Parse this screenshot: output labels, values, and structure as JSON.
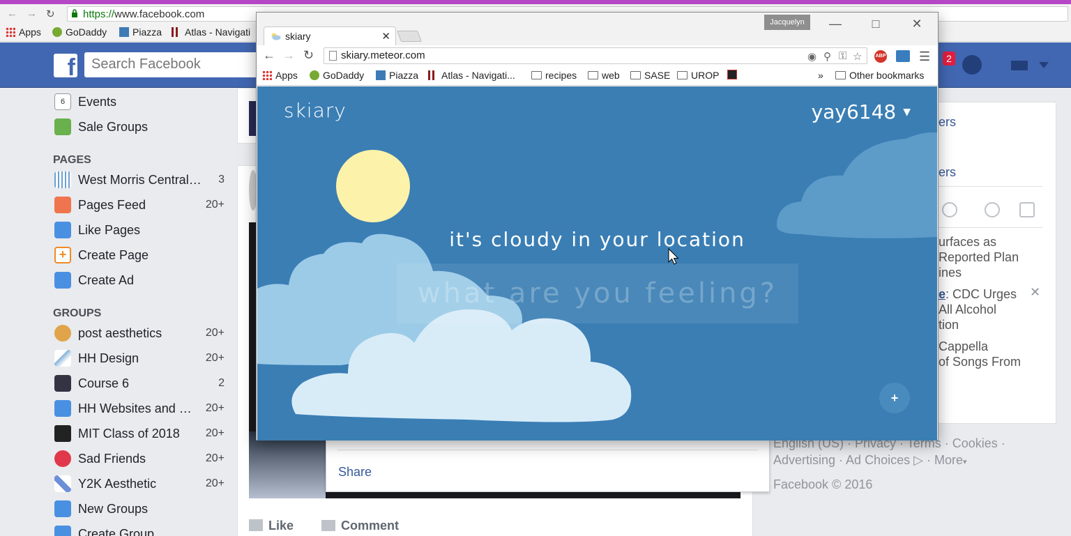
{
  "bg_browser": {
    "url_https": "https://",
    "url_rest": "www.facebook.com",
    "bookmarks": [
      "Apps",
      "GoDaddy",
      "Piazza",
      "Atlas - Navigati"
    ]
  },
  "facebook": {
    "search_placeholder": "Search Facebook",
    "explore": [
      {
        "label": "Events",
        "count": ""
      },
      {
        "label": "Sale Groups",
        "count": ""
      }
    ],
    "pages_heading": "PAGES",
    "pages": [
      {
        "label": "West Morris Central…",
        "count": "3"
      },
      {
        "label": "Pages Feed",
        "count": "20+"
      },
      {
        "label": "Like Pages",
        "count": ""
      },
      {
        "label": "Create Page",
        "count": ""
      },
      {
        "label": "Create Ad",
        "count": ""
      }
    ],
    "groups_heading": "GROUPS",
    "groups": [
      {
        "label": "post aesthetics",
        "count": "20+"
      },
      {
        "label": "HH Design",
        "count": "20+"
      },
      {
        "label": "Course 6",
        "count": "2"
      },
      {
        "label": "HH Websites and …",
        "count": "20+"
      },
      {
        "label": "MIT Class of 2018",
        "count": "20+"
      },
      {
        "label": "Sad Friends",
        "count": "20+"
      },
      {
        "label": "Y2K Aesthetic",
        "count": "20+"
      },
      {
        "label": "New Groups",
        "count": ""
      },
      {
        "label": "Create Group",
        "count": ""
      }
    ],
    "share_label": "Share",
    "like_label": "Like",
    "comment_label": "Comment",
    "notification_count": "2",
    "right_links": [
      "ers",
      "ers"
    ],
    "trending": [
      {
        "lines": [
          "urfaces as",
          "Reported Plan",
          "ines"
        ]
      },
      {
        "prefix": "e",
        "lines": [
          ": CDC Urges",
          "All Alcohol",
          "tion"
        ]
      },
      {
        "lines": [
          "Cappella",
          "of Songs From"
        ]
      }
    ],
    "footer_line1": "English (US) · Privacy · Terms · Cookies ·",
    "footer_line2": "Advertising · Ad Choices",
    "footer_more": "More",
    "footer_copy": "Facebook © 2016"
  },
  "window": {
    "profile_name": "Jacquelyn",
    "tab_title": "skiary",
    "url": "skiary.meteor.com",
    "bookmarks": [
      "Apps",
      "GoDaddy",
      "Piazza",
      "Atlas - Navigati...",
      "recipes",
      "web",
      "SASE",
      "UROP"
    ],
    "overflow": "»",
    "other_bookmarks": "Other bookmarks"
  },
  "app": {
    "logo": "skiary",
    "username": "yay6148",
    "headline": "it's cloudy in your location",
    "feeling_placeholder": "what are you feeling?",
    "fab_label": "+"
  },
  "colors": {
    "sky": "#3a7eb4",
    "sun": "#fdf2a9",
    "cloud_light": "#d8ecf8",
    "cloud_mid": "#9ccbe8",
    "facebook_blue": "#4267b2"
  }
}
